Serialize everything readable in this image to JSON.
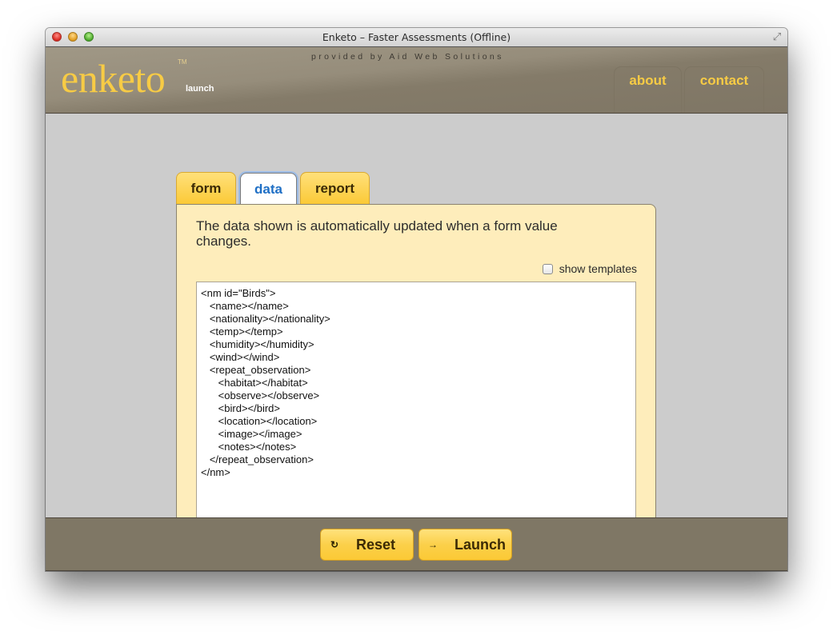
{
  "window": {
    "title": "Enketo – Faster Assessments (Offline)"
  },
  "header": {
    "logo": "enketo",
    "logo_tm": "TM",
    "logo_sub": "launch",
    "provided_by": "provided by Aid Web Solutions",
    "nav": [
      {
        "label": "about"
      },
      {
        "label": "contact"
      }
    ]
  },
  "tabs": [
    {
      "label": "form",
      "active": false
    },
    {
      "label": "data",
      "active": true
    },
    {
      "label": "report",
      "active": false
    }
  ],
  "panel": {
    "description": "The data shown is automatically updated when a form value changes.",
    "show_templates_label": "show templates",
    "show_templates_checked": false,
    "xml_lines": [
      "<nm id=\"Birds\">",
      "   <name></name>",
      "   <nationality></nationality>",
      "   <temp></temp>",
      "   <humidity></humidity>",
      "   <wind></wind>",
      "   <repeat_observation>",
      "      <habitat></habitat>",
      "      <observe></observe>",
      "      <bird></bird>",
      "      <location></location>",
      "      <image></image>",
      "      <notes></notes>",
      "   </repeat_observation>",
      "</nm>"
    ]
  },
  "footer": {
    "reset_label": "Reset",
    "reset_icon": "↻",
    "launch_label": "Launch",
    "launch_icon": "→"
  },
  "colors": {
    "brand_yellow": "#f7cb45",
    "header_brown": "#968d7b",
    "panel_bg": "#feedbb",
    "active_tab_text": "#1f6fc5"
  }
}
